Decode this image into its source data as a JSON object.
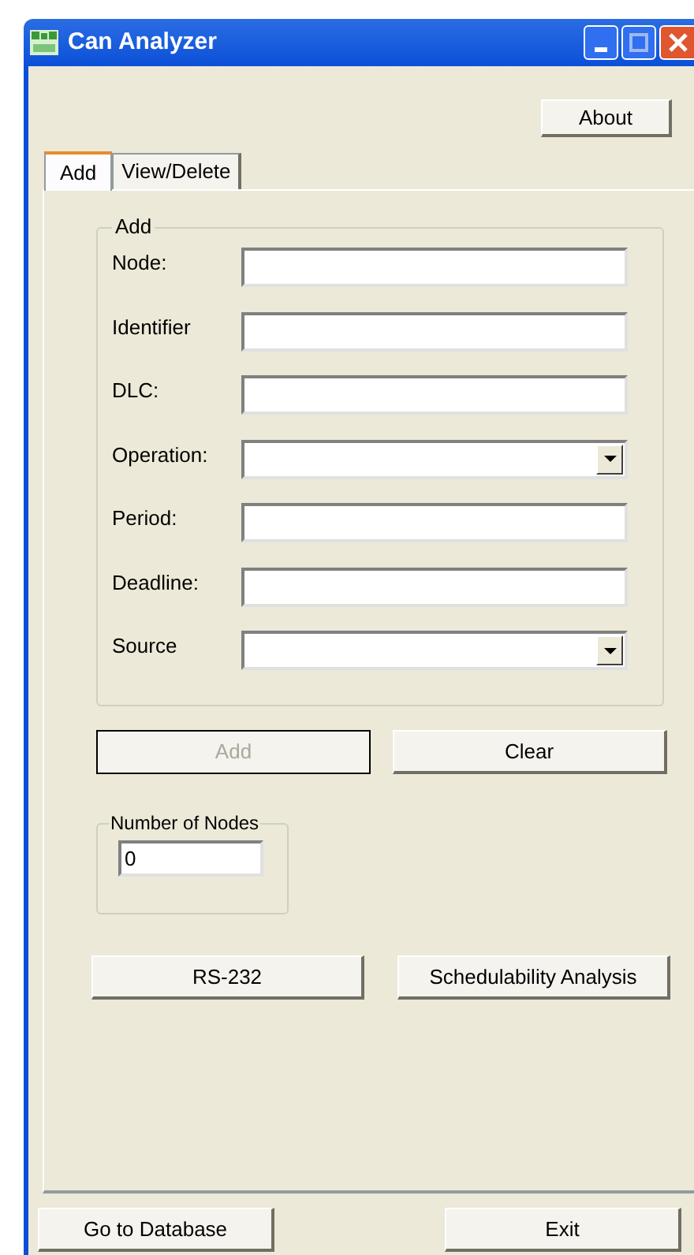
{
  "window": {
    "title": "Can Analyzer"
  },
  "about_button": "About",
  "tabs": [
    {
      "label": "Add",
      "selected": true
    },
    {
      "label": "View/Delete",
      "selected": false
    }
  ],
  "add_group": {
    "title": "Add",
    "fields": [
      {
        "label": "Node:",
        "kind": "text"
      },
      {
        "label": "Identifier",
        "kind": "text"
      },
      {
        "label": "DLC:",
        "kind": "text"
      },
      {
        "label": "Operation:",
        "kind": "dropdown"
      },
      {
        "label": "Period:",
        "kind": "text"
      },
      {
        "label": "Deadline:",
        "kind": "text"
      },
      {
        "label": "Source",
        "kind": "dropdown"
      }
    ]
  },
  "form_buttons": [
    {
      "label": "Add",
      "disabled": true
    },
    {
      "label": "Clear",
      "disabled": false
    }
  ],
  "nodes_group": {
    "title": "Number of Nodes",
    "value": "0"
  },
  "action_buttons": [
    "RS-232",
    "Schedulability Analysis"
  ],
  "footer_buttons": [
    "Go to Database",
    "Exit"
  ]
}
